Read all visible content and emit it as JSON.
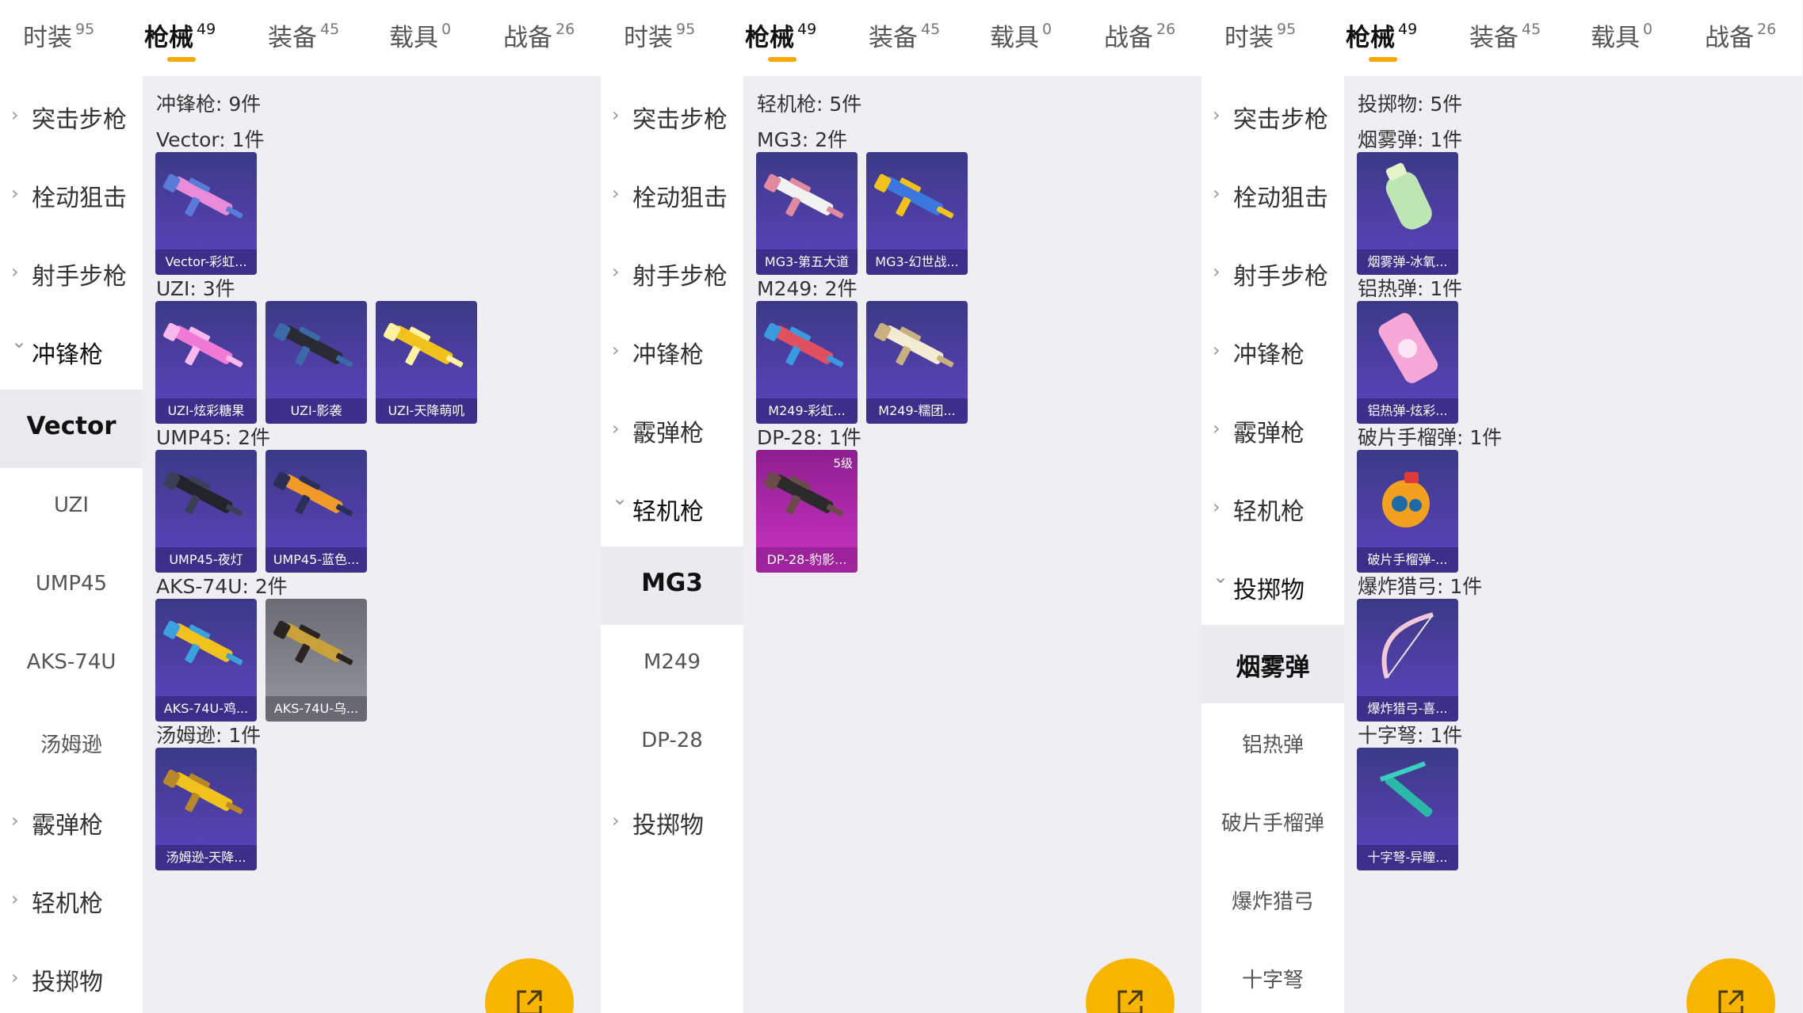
{
  "colors": {
    "accent": "#f5a800",
    "card_purple": "#4f3fa6",
    "card_gray": "#85858e",
    "card_pink": "#b32bb0"
  },
  "panels": [
    {
      "tabs": [
        {
          "label": "时装",
          "count": "95"
        },
        {
          "label": "枪械",
          "count": "49",
          "active": true
        },
        {
          "label": "装备",
          "count": "45"
        },
        {
          "label": "载具",
          "count": "0"
        },
        {
          "label": "战备",
          "count": "26"
        }
      ],
      "sidebar_top": [
        "突击步枪",
        "栓动狙击",
        "射手步枪"
      ],
      "sidebar_expanded": "冲锋枪",
      "sidebar_sub": [
        "Vector",
        "UZI",
        "UMP45",
        "AKS-74U",
        "汤姆逊"
      ],
      "sidebar_selected": "Vector",
      "sidebar_bottom": [
        "霰弹枪",
        "轻机枪",
        "投掷物"
      ],
      "category_header": "冲锋枪: 9件",
      "groups": [
        {
          "header": "Vector: 1件",
          "items": [
            {
              "name": "Vector-彩虹...",
              "icon": "smg-vector-icon",
              "style": "purple"
            }
          ]
        },
        {
          "header": "UZI: 3件",
          "items": [
            {
              "name": "UZI-炫彩糖果",
              "icon": "uzi-pink-icon",
              "style": "purple"
            },
            {
              "name": "UZI-影袭",
              "icon": "uzi-dark-icon",
              "style": "purple"
            },
            {
              "name": "UZI-天降萌叽",
              "icon": "uzi-yellow-icon",
              "style": "purple"
            }
          ]
        },
        {
          "header": "UMP45: 2件",
          "items": [
            {
              "name": "UMP45-夜灯",
              "icon": "ump45-dark-icon",
              "style": "purple"
            },
            {
              "name": "UMP45-蓝色...",
              "icon": "ump45-orange-icon",
              "style": "purple"
            }
          ]
        },
        {
          "header": "AKS-74U: 2件",
          "items": [
            {
              "name": "AKS-74U-鸡...",
              "icon": "aks74u-yellow-icon",
              "style": "purple"
            },
            {
              "name": "AKS-74U-乌...",
              "icon": "aks74u-gold-icon",
              "style": "gray"
            }
          ]
        },
        {
          "header": "汤姆逊: 1件",
          "items": [
            {
              "name": "汤姆逊-天降...",
              "icon": "thompson-yellow-icon",
              "style": "purple"
            }
          ]
        }
      ]
    },
    {
      "tabs": [
        {
          "label": "时装",
          "count": "95"
        },
        {
          "label": "枪械",
          "count": "49",
          "active": true
        },
        {
          "label": "装备",
          "count": "45"
        },
        {
          "label": "载具",
          "count": "0"
        },
        {
          "label": "战备",
          "count": "26"
        }
      ],
      "sidebar_top": [
        "突击步枪",
        "栓动狙击",
        "射手步枪",
        "冲锋枪",
        "霰弹枪"
      ],
      "sidebar_expanded": "轻机枪",
      "sidebar_sub": [
        "MG3",
        "M249",
        "DP-28"
      ],
      "sidebar_selected": "MG3",
      "sidebar_bottom": [
        "投掷物"
      ],
      "category_header": "轻机枪: 5件",
      "groups": [
        {
          "header": "MG3: 2件",
          "items": [
            {
              "name": "MG3-第五大道",
              "icon": "mg3-white-icon",
              "style": "purple"
            },
            {
              "name": "MG3-幻世战...",
              "icon": "mg3-blue-icon",
              "style": "purple"
            }
          ]
        },
        {
          "header": "M249: 2件",
          "items": [
            {
              "name": "M249-彩虹...",
              "icon": "m249-rainbow-icon",
              "style": "purple"
            },
            {
              "name": "M249-糯团...",
              "icon": "m249-cream-icon",
              "style": "purple"
            }
          ]
        },
        {
          "header": "DP-28: 1件",
          "items": [
            {
              "name": "DP-28-豹影...",
              "icon": "dp28-dark-icon",
              "style": "pink",
              "tier": "5级"
            }
          ]
        }
      ]
    },
    {
      "tabs": [
        {
          "label": "时装",
          "count": "95"
        },
        {
          "label": "枪械",
          "count": "49",
          "active": true
        },
        {
          "label": "装备",
          "count": "45"
        },
        {
          "label": "载具",
          "count": "0"
        },
        {
          "label": "战备",
          "count": "26"
        }
      ],
      "sidebar_top": [
        "突击步枪",
        "栓动狙击",
        "射手步枪",
        "冲锋枪",
        "霰弹枪",
        "轻机枪"
      ],
      "sidebar_expanded": "投掷物",
      "sidebar_sub": [
        "烟雾弹",
        "铝热弹",
        "破片手榴弹",
        "爆炸猎弓",
        "十字弩"
      ],
      "sidebar_selected": "烟雾弹",
      "sidebar_bottom": [],
      "category_header": "投掷物: 5件",
      "groups": [
        {
          "header": "烟雾弹: 1件",
          "items": [
            {
              "name": "烟雾弹-冰氧...",
              "icon": "smoke-grenade-icon",
              "style": "purple"
            }
          ]
        },
        {
          "header": "铝热弹: 1件",
          "items": [
            {
              "name": "铝热弹-炫彩...",
              "icon": "thermite-grenade-icon",
              "style": "purple"
            }
          ]
        },
        {
          "header": "破片手榴弹: 1件",
          "items": [
            {
              "name": "破片手榴弹-...",
              "icon": "frag-grenade-icon",
              "style": "purple"
            }
          ]
        },
        {
          "header": "爆炸猎弓: 1件",
          "items": [
            {
              "name": "爆炸猎弓-喜...",
              "icon": "explosive-bow-icon",
              "style": "purple"
            }
          ]
        },
        {
          "header": "十字弩: 1件",
          "items": [
            {
              "name": "十字弩-异瞳...",
              "icon": "crossbow-icon",
              "style": "purple"
            }
          ]
        }
      ]
    }
  ]
}
